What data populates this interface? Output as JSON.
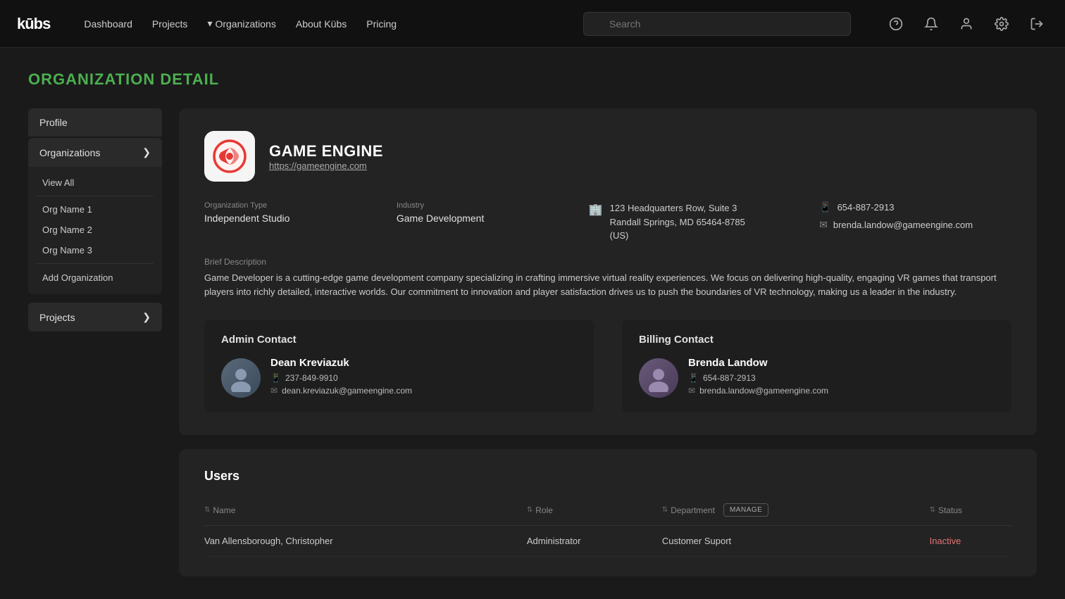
{
  "nav": {
    "logo": "kūbs",
    "links": [
      {
        "label": "Dashboard",
        "id": "dashboard"
      },
      {
        "label": "Projects",
        "id": "projects",
        "hasDropdown": false
      },
      {
        "label": "Organizations",
        "id": "organizations",
        "hasDropdown": true
      },
      {
        "label": "About Kübs",
        "id": "about"
      },
      {
        "label": "Pricing",
        "id": "pricing"
      }
    ],
    "search_placeholder": "Search",
    "icons": [
      "help",
      "bell",
      "user",
      "settings",
      "logout"
    ]
  },
  "page": {
    "title": "ORGANIZATION DETAIL"
  },
  "sidebar": {
    "profile_label": "Profile",
    "orgs_label": "Organizations",
    "orgs_subitems": [
      {
        "label": "View All"
      },
      {
        "label": "Org Name 1"
      },
      {
        "label": "Org Name 2"
      },
      {
        "label": "Org Name 3"
      }
    ],
    "add_org_label": "Add Organization",
    "projects_label": "Projects"
  },
  "org": {
    "name": "GAME ENGINE",
    "url": "https://gameengine.com",
    "org_type_label": "Organization Type",
    "org_type_value": "Independent Studio",
    "industry_label": "Industry",
    "industry_value": "Game Development",
    "address": "123 Headquarters Row, Suite 3\nRandall Springs, MD 65464-8785\n(US)",
    "phone": "654-887-2913",
    "email": "brenda.landow@gameengine.com",
    "desc_label": "Brief Description",
    "desc_text": "Game Developer is a cutting-edge game development company specializing in crafting immersive virtual reality experiences. We focus on delivering high-quality, engaging VR games that transport players into richly detailed, interactive worlds. Our commitment to innovation and player satisfaction drives us to push the boundaries of VR technology, making us a leader in the industry.",
    "admin_contact": {
      "section_title": "Admin Contact",
      "name": "Dean Kreviazuk",
      "phone": "237-849-9910",
      "email": "dean.kreviazuk@gameengine.com"
    },
    "billing_contact": {
      "section_title": "Billing Contact",
      "name": "Brenda Landow",
      "phone": "654-887-2913",
      "email": "brenda.landow@gameengine.com"
    }
  },
  "users": {
    "section_title": "Users",
    "columns": [
      {
        "label": "Name",
        "id": "name"
      },
      {
        "label": "Role",
        "id": "role"
      },
      {
        "label": "Department",
        "id": "department"
      },
      {
        "label": "Status",
        "id": "status"
      }
    ],
    "manage_label": "MANAGE",
    "rows": [
      {
        "name": "Van Allensborough, Christopher",
        "role": "Administrator",
        "department": "Customer Suport",
        "status": "Inactive"
      }
    ]
  }
}
